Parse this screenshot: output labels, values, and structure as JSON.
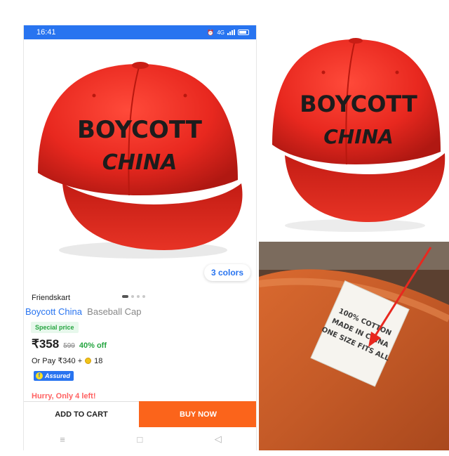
{
  "status_bar": {
    "time": "16:41",
    "network": "4G"
  },
  "product": {
    "cap_text_line1": "BOYCOTT",
    "cap_text_line2": "CHINA",
    "colors_chip": "3 colors",
    "brand": "Friendskart",
    "title_highlight": "Boycott China",
    "title_rest": "Baseball Cap",
    "special_price_badge": "Special price",
    "price": "₹358",
    "mrp": "599",
    "discount": "40% off",
    "or_pay_prefix": "Or Pay ₹340 +",
    "coins": "18",
    "assured_label": "Assured",
    "hurry": "Hurry, Only 4 left!"
  },
  "actions": {
    "add_to_cart": "ADD TO CART",
    "buy_now": "BUY NOW"
  },
  "nav_bar": {
    "menu_icon": "≡",
    "home_icon": "□",
    "back_icon": "◁"
  },
  "tag_label": {
    "line1": "100% COTTON",
    "line2": "MADE IN CHINA",
    "line3": "ONE SIZE FITS ALL"
  },
  "colors": {
    "accent": "#2874f0",
    "buy_now": "#fb641b",
    "cap_red": "#e8281f",
    "arrow": "#e8281f"
  }
}
